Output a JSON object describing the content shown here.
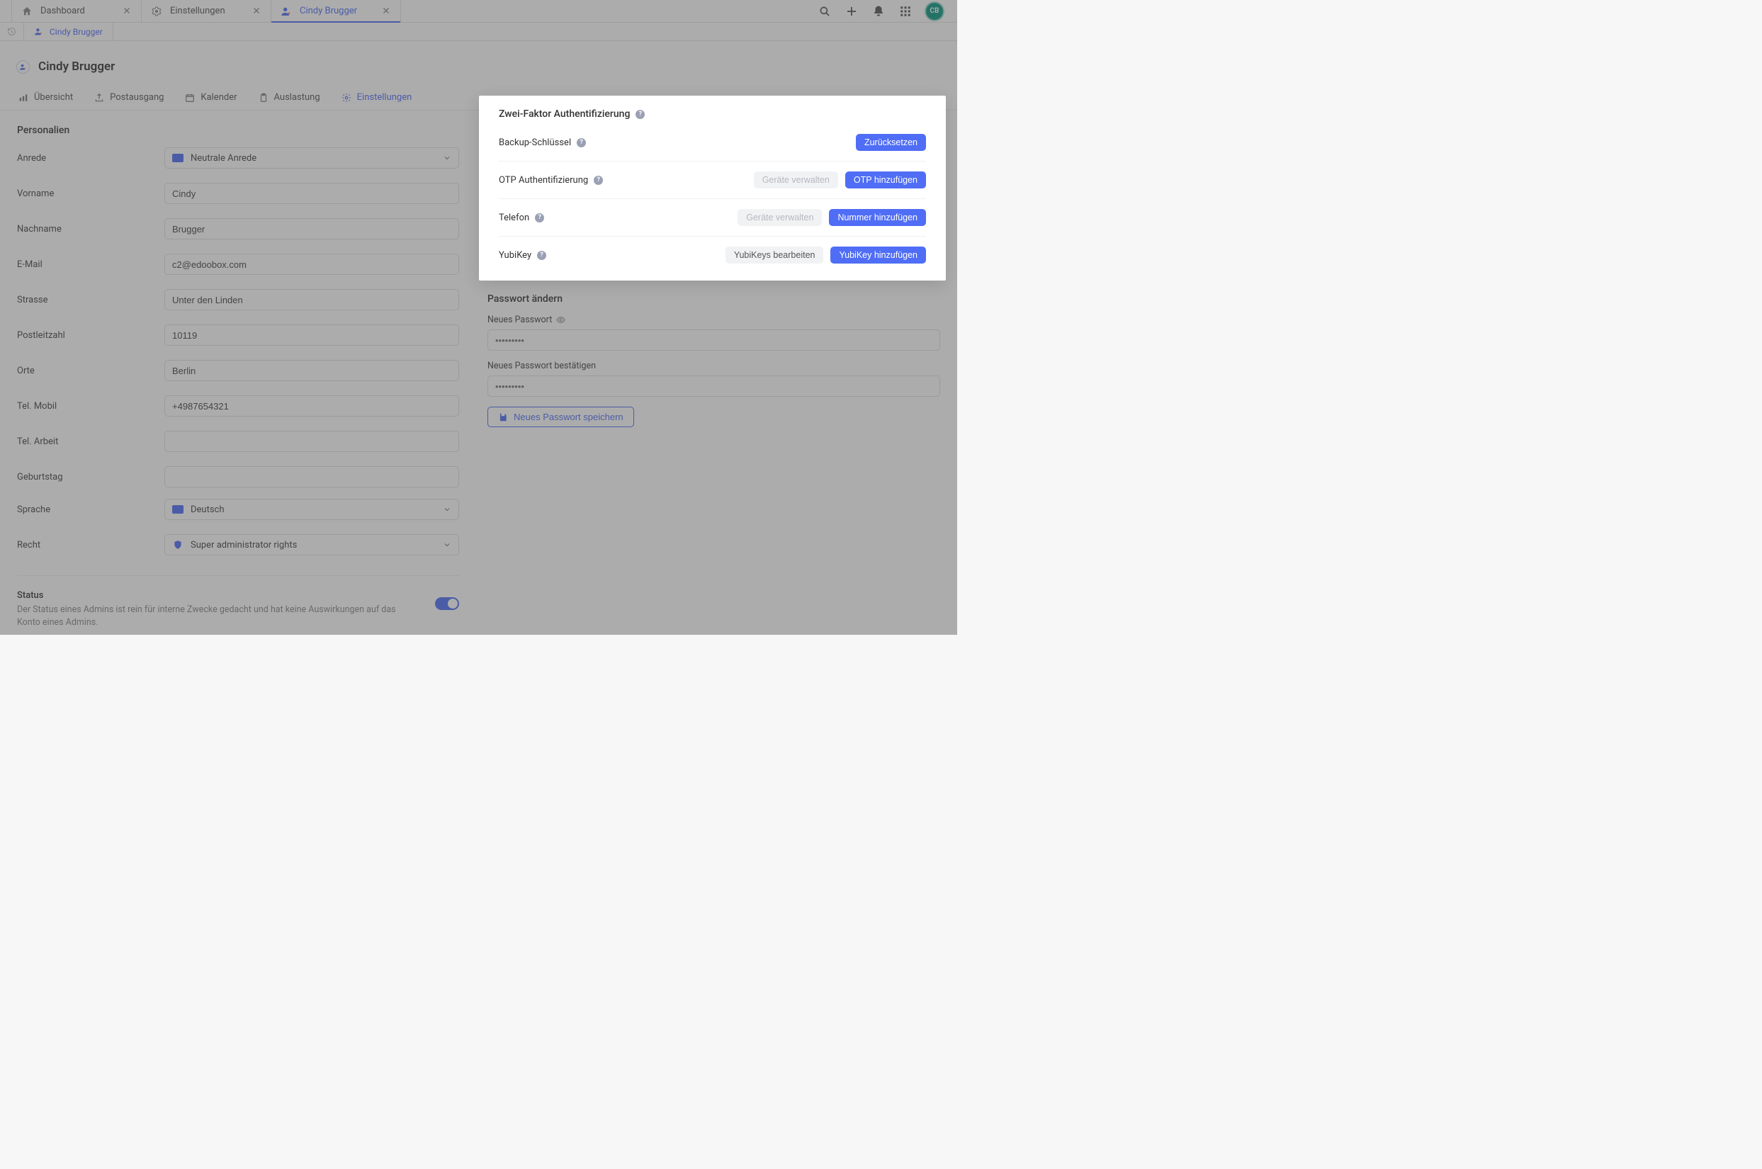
{
  "topTabs": {
    "dashboard": "Dashboard",
    "settings": "Einstellungen",
    "user": "Cindy Brugger"
  },
  "avatar": "CB",
  "breadcrumb": "Cindy Brugger",
  "header": {
    "title": "Cindy Brugger"
  },
  "pageTabs": {
    "overview": "Übersicht",
    "outbox": "Postausgang",
    "calendar": "Kalender",
    "workload": "Auslastung",
    "settings": "Einstellungen"
  },
  "personal": {
    "sectionTitle": "Personalien",
    "labels": {
      "salutation": "Anrede",
      "firstName": "Vorname",
      "lastName": "Nachname",
      "email": "E-Mail",
      "street": "Strasse",
      "zip": "Postleitzahl",
      "city": "Orte",
      "mobile": "Tel. Mobil",
      "work": "Tel. Arbeit",
      "birthday": "Geburtstag",
      "language": "Sprache",
      "rights": "Recht"
    },
    "values": {
      "salutation": "Neutrale Anrede",
      "firstName": "Cindy",
      "lastName": "Brugger",
      "email": "c2@edoobox.com",
      "street": "Unter den Linden",
      "zip": "10119",
      "city": "Berlin",
      "mobile": "+4987654321",
      "work": "",
      "birthday": "",
      "language": "Deutsch",
      "rights": "Super administrator rights"
    }
  },
  "status": {
    "title": "Status",
    "desc": "Der Status eines Admins ist rein für interne Zwecke gedacht und hat keine Auswirkungen auf das Konto eines Admins."
  },
  "twofa": {
    "title": "Zwei-Faktor Authentifizierung",
    "rows": {
      "backup": {
        "label": "Backup-Schlüssel",
        "primary": "Zurücksetzen"
      },
      "otp": {
        "label": "OTP Authentifizierung",
        "secondary": "Geräte verwalten",
        "primary": "OTP hinzufügen"
      },
      "phone": {
        "label": "Telefon",
        "secondary": "Geräte verwalten",
        "primary": "Nummer hinzufügen"
      },
      "yubi": {
        "label": "YubiKey",
        "secondary": "YubiKeys bearbeiten",
        "primary": "YubiKey hinzufügen"
      }
    }
  },
  "password": {
    "title": "Passwort ändern",
    "new": "Neues Passwort",
    "confirm": "Neues Passwort bestätigen",
    "placeholder": "•••••••••",
    "save": "Neues Passwort speichern"
  }
}
